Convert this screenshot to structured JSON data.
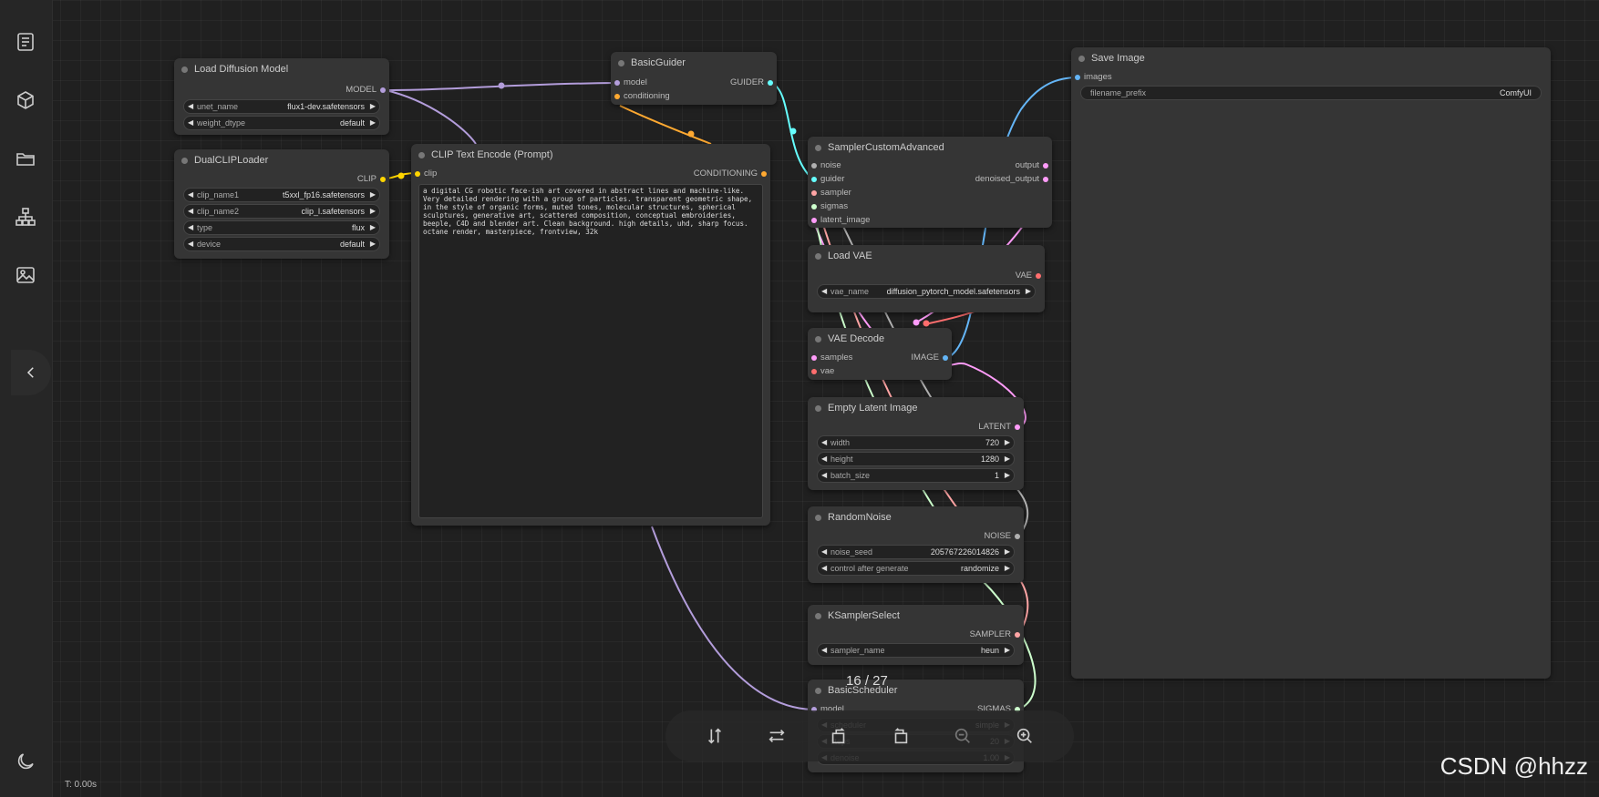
{
  "sidebar": {
    "items": [
      "queue-icon",
      "model-library-icon",
      "workflows-icon",
      "node-library-icon",
      "image-gallery-icon"
    ]
  },
  "colors": {
    "model": "#b39ddb",
    "clip": "#ffd500",
    "conditioning": "#ffa931",
    "vae": "#ff6e6e",
    "latent": "#ff9cf9",
    "image": "#64b5f6",
    "noise": "#b0b0b0",
    "guider": "#66ffff",
    "sampler": "#ffa5a5",
    "sigmas": "#cdffcd"
  },
  "nodes": {
    "load_diffusion": {
      "title": "Load Diffusion Model",
      "out": "MODEL",
      "w1_label": "unet_name",
      "w1_value": "flux1-dev.safetensors",
      "w2_label": "weight_dtype",
      "w2_value": "default"
    },
    "dualclip": {
      "title": "DualCLIPLoader",
      "out": "CLIP",
      "w1_label": "clip_name1",
      "w1_value": "t5xxl_fp16.safetensors",
      "w2_label": "clip_name2",
      "w2_value": "clip_l.safetensors",
      "w3_label": "type",
      "w3_value": "flux",
      "w4_label": "device",
      "w4_value": "default"
    },
    "basic_guider": {
      "title": "BasicGuider",
      "in1": "model",
      "in2": "conditioning",
      "out": "GUIDER"
    },
    "clip_text": {
      "title": "CLIP Text Encode (Prompt)",
      "in1": "clip",
      "out": "CONDITIONING",
      "prompt": "a digital CG robotic face-ish art covered in abstract lines and machine-like. Very detailed rendering with a group of particles. transparent geometric shape, in the style of organic forms, muted tones, molecular structures, spherical sculptures, generative art, scattered composition, conceptual embroideries, beeple, C4D and blender art. Clean background. high details, uhd, sharp focus. octane render, masterpiece, frontview, 32k"
    },
    "sampler_adv": {
      "title": "SamplerCustomAdvanced",
      "in1": "noise",
      "in2": "guider",
      "in3": "sampler",
      "in4": "sigmas",
      "in5": "latent_image",
      "out1": "output",
      "out2": "denoised_output"
    },
    "load_vae": {
      "title": "Load VAE",
      "out": "VAE",
      "w1_label": "vae_name",
      "w1_value": "diffusion_pytorch_model.safetensors"
    },
    "vae_decode": {
      "title": "VAE Decode",
      "in1": "samples",
      "in2": "vae",
      "out": "IMAGE"
    },
    "empty_latent": {
      "title": "Empty Latent Image",
      "out": "LATENT",
      "w1_label": "width",
      "w1_value": "720",
      "w2_label": "height",
      "w2_value": "1280",
      "w3_label": "batch_size",
      "w3_value": "1"
    },
    "random_noise": {
      "title": "RandomNoise",
      "out": "NOISE",
      "w1_label": "noise_seed",
      "w1_value": "205767226014826",
      "w2_label": "control after generate",
      "w2_value": "randomize"
    },
    "ksampler_select": {
      "title": "KSamplerSelect",
      "out": "SAMPLER",
      "w1_label": "sampler_name",
      "w1_value": "heun"
    },
    "basic_scheduler": {
      "title": "BasicScheduler",
      "in1": "model",
      "out": "SIGMAS",
      "w1_label": "scheduler",
      "w1_value": "simple",
      "w2_label": "steps",
      "w2_value": "20",
      "w3_label": "denoise",
      "w3_value": "1.00"
    },
    "save_image": {
      "title": "Save Image",
      "in1": "images",
      "w1_label": "filename_prefix",
      "w1_value": "ComfyUI"
    }
  },
  "viewer": {
    "page_counter": "16 / 27"
  },
  "status": {
    "timing": "T: 0.00s"
  },
  "watermark": "CSDN @hhzz"
}
